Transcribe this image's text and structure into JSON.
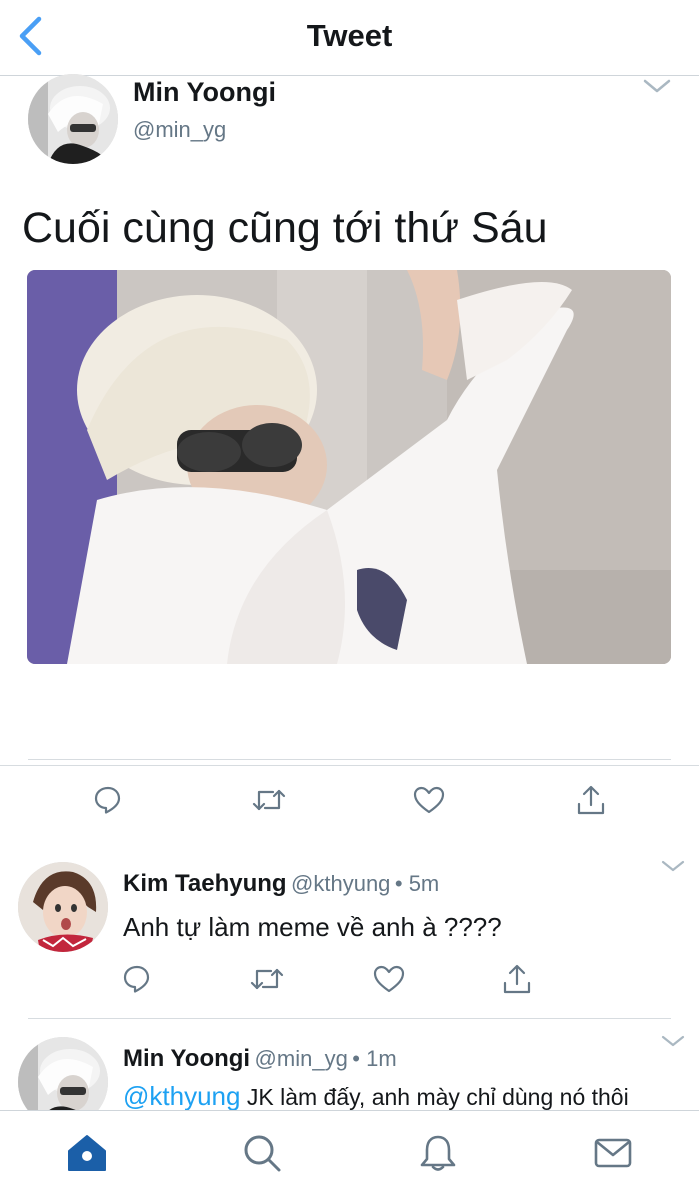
{
  "nav": {
    "title": "Tweet",
    "back_icon": "chevron-left-icon"
  },
  "tweet": {
    "author_name": "Min Yoongi",
    "author_handle": "@min_yg",
    "text": "Cuối cùng cũng tới thứ Sáu",
    "media_description_icon": "photo",
    "actions": [
      "reply-icon",
      "retweet-icon",
      "like-icon",
      "share-icon"
    ]
  },
  "replies": [
    {
      "name": "Kim Taehyung",
      "handle": "@kthyung",
      "time": "• 5m",
      "text": "Anh tự làm meme về anh à ????"
    },
    {
      "name": "Min Yoongi",
      "handle": "@min_yg",
      "time": "• 1m",
      "mention": "@kthyung",
      "text": " JK làm đấy, anh mày chỉ dùng nó thôi"
    }
  ],
  "tabbar": {
    "icons": [
      "home-icon",
      "search-icon",
      "notifications-icon",
      "messages-icon"
    ]
  },
  "colors": {
    "accent": "#1da1f2",
    "nav_blue": "#4a9ff5",
    "text": "#14171a",
    "muted": "#657786",
    "divider": "#d7dce0",
    "icon_gray": "#657786",
    "home_active": "#1b5fa8"
  }
}
